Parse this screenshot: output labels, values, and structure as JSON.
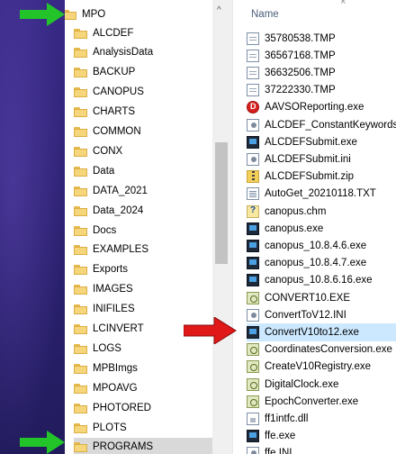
{
  "tree": {
    "root": "MPO",
    "folders": [
      "ALCDEF",
      "AnalysisData",
      "BACKUP",
      "CANOPUS",
      "CHARTS",
      "COMMON",
      "CONX",
      "Data",
      "DATA_2021",
      "Data_2024",
      "Docs",
      "EXAMPLES",
      "Exports",
      "IMAGES",
      "INIFILES",
      "LCINVERT",
      "LOGS",
      "MPBImgs",
      "MPOAVG",
      "PHOTORED",
      "PLOTS",
      "PROGRAMS"
    ]
  },
  "files": {
    "header": "Name",
    "items": [
      {
        "name": "35780538.TMP",
        "icon": "doc"
      },
      {
        "name": "36567168.TMP",
        "icon": "doc"
      },
      {
        "name": "36632506.TMP",
        "icon": "doc"
      },
      {
        "name": "37222330.TMP",
        "icon": "doc"
      },
      {
        "name": "AAVSOReporting.exe",
        "icon": "red"
      },
      {
        "name": "ALCDEF_ConstantKeywords.ini",
        "icon": "ini"
      },
      {
        "name": "ALCDEFSubmit.exe",
        "icon": "app"
      },
      {
        "name": "ALCDEFSubmit.ini",
        "icon": "ini"
      },
      {
        "name": "ALCDEFSubmit.zip",
        "icon": "zip"
      },
      {
        "name": "AutoGet_20210118.TXT",
        "icon": "txt"
      },
      {
        "name": "canopus.chm",
        "icon": "chm"
      },
      {
        "name": "canopus.exe",
        "icon": "app"
      },
      {
        "name": "canopus_10.8.4.6.exe",
        "icon": "app"
      },
      {
        "name": "canopus_10.8.4.7.exe",
        "icon": "app"
      },
      {
        "name": "canopus_10.8.6.16.exe",
        "icon": "app"
      },
      {
        "name": "CONVERT10.EXE",
        "icon": "cfg"
      },
      {
        "name": "ConvertToV12.INI",
        "icon": "ini"
      },
      {
        "name": "ConvertV10to12.exe",
        "icon": "app"
      },
      {
        "name": "CoordinatesConversion.exe",
        "icon": "cfg"
      },
      {
        "name": "CreateV10Registry.exe",
        "icon": "cfg"
      },
      {
        "name": "DigitalClock.exe",
        "icon": "cfg"
      },
      {
        "name": "EpochConverter.exe",
        "icon": "cfg"
      },
      {
        "name": "ff1intfc.dll",
        "icon": "dll"
      },
      {
        "name": "ffe.exe",
        "icon": "app"
      },
      {
        "name": "ffe.INI",
        "icon": "ini"
      }
    ]
  },
  "colors": {
    "arrow_green": "#22c42a",
    "arrow_red": "#e01818",
    "highlight": "#cce8ff"
  }
}
